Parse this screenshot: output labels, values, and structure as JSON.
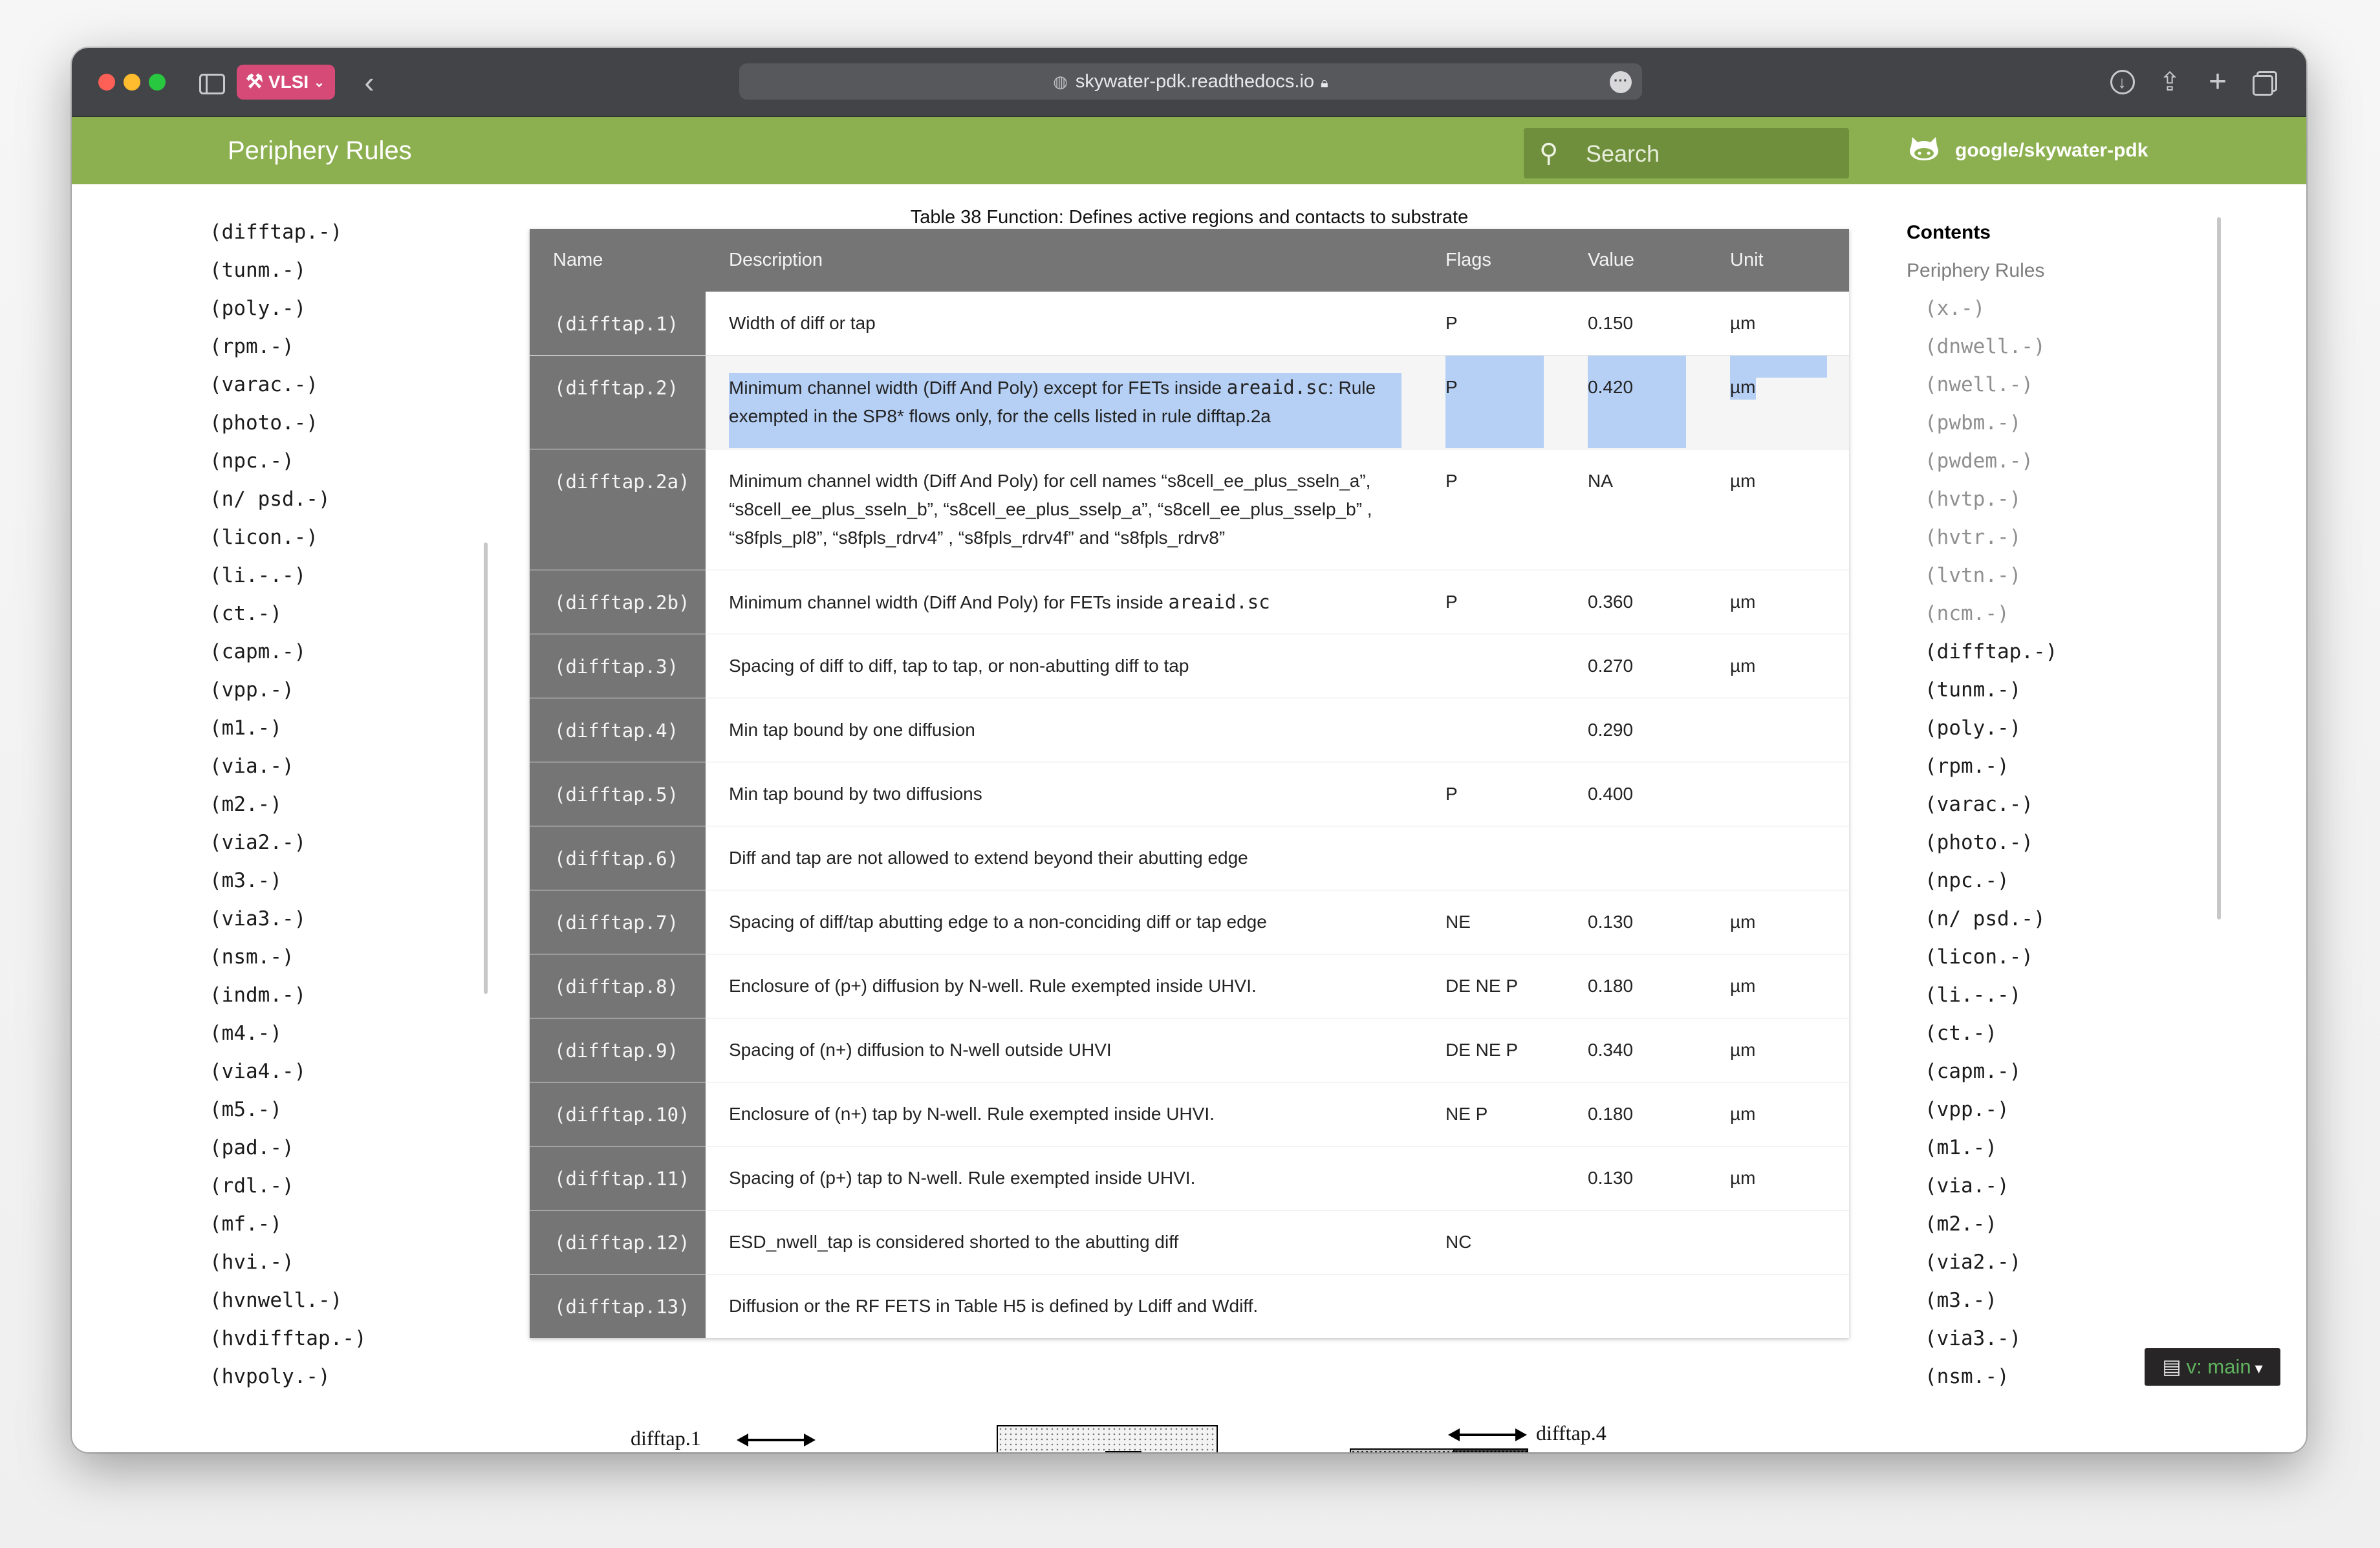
{
  "browser": {
    "tab_group_label": "VLSI",
    "url": "skywater-pdk.readthedocs.io"
  },
  "header": {
    "title": "Periphery Rules",
    "search_placeholder": "Search",
    "repo": "google/skywater-pdk"
  },
  "left_nav": [
    "(difftap.-)",
    "(tunm.-)",
    "(poly.-)",
    "(rpm.-)",
    "(varac.-)",
    "(photo.-)",
    "(npc.-)",
    "(n/ psd.-)",
    "(licon.-)",
    "(li.-.-)",
    "(ct.-)",
    "(capm.-)",
    "(vpp.-)",
    "(m1.-)",
    "(via.-)",
    "(m2.-)",
    "(via2.-)",
    "(m3.-)",
    "(via3.-)",
    "(nsm.-)",
    "(indm.-)",
    "(m4.-)",
    "(via4.-)",
    "(m5.-)",
    "(pad.-)",
    "(rdl.-)",
    "(mf.-)",
    "(hvi.-)",
    "(hvnwell.-)",
    "(hvdifftap.-)",
    "(hvpoly.-)"
  ],
  "toc": {
    "title": "Contents",
    "root": "Periphery Rules",
    "items": [
      "(x.-)",
      "(dnwell.-)",
      "(nwell.-)",
      "(pwbm.-)",
      "(pwdem.-)",
      "(hvtp.-)",
      "(hvtr.-)",
      "(lvtn.-)",
      "(ncm.-)",
      "(difftap.-)",
      "(tunm.-)",
      "(poly.-)",
      "(rpm.-)",
      "(varac.-)",
      "(photo.-)",
      "(npc.-)",
      "(n/ psd.-)",
      "(licon.-)",
      "(li.-.-)",
      "(ct.-)",
      "(capm.-)",
      "(vpp.-)",
      "(m1.-)",
      "(via.-)",
      "(m2.-)",
      "(via2.-)",
      "(m3.-)",
      "(via3.-)",
      "(nsm.-)"
    ]
  },
  "version_badge": "v: main",
  "table": {
    "caption": "Table 38 Function: Defines active regions and contacts to substrate",
    "headers": {
      "name": "Name",
      "description": "Description",
      "flags": "Flags",
      "value": "Value",
      "unit": "Unit"
    },
    "rows": [
      {
        "name": "(difftap.1)",
        "description": "Width of diff or tap",
        "flags": "P",
        "value": "0.150",
        "unit": "µm"
      },
      {
        "name": "(difftap.2)",
        "description_pre": "Minimum channel width (Diff And Poly) except for FETs inside ",
        "description_code": "areaid.sc",
        "description_post": ": Rule exempted in the SP8* flows only, for the cells listed in rule difftap.2a",
        "flags": "P",
        "value": "0.420",
        "unit": "µm"
      },
      {
        "name": "(difftap.2a)",
        "description": "Minimum channel width (Diff And Poly) for cell names “s8cell_ee_plus_sseln_a”, “s8cell_ee_plus_sseln_b”, “s8cell_ee_plus_sselp_a”, “s8cell_ee_plus_sselp_b” , “s8fpls_pl8”, “s8fpls_rdrv4” , “s8fpls_rdrv4f” and “s8fpls_rdrv8”",
        "flags": "P",
        "value": "NA",
        "unit": "µm"
      },
      {
        "name": "(difftap.2b)",
        "description_pre": "Minimum channel width (Diff And Poly) for FETs inside ",
        "description_code": "areaid.sc",
        "flags": "P",
        "value": "0.360",
        "unit": "µm"
      },
      {
        "name": "(difftap.3)",
        "description": "Spacing of diff to diff, tap to tap, or non-abutting diff to tap",
        "flags": "",
        "value": "0.270",
        "unit": "µm"
      },
      {
        "name": "(difftap.4)",
        "description": "Min tap bound by one diffusion",
        "flags": "",
        "value": "0.290",
        "unit": ""
      },
      {
        "name": "(difftap.5)",
        "description": "Min tap bound by two diffusions",
        "flags": "P",
        "value": "0.400",
        "unit": ""
      },
      {
        "name": "(difftap.6)",
        "description": "Diff and tap are not allowed to extend beyond their abutting edge",
        "flags": "",
        "value": "",
        "unit": ""
      },
      {
        "name": "(difftap.7)",
        "description": "Spacing of diff/tap abutting edge to a non-conciding diff or tap edge",
        "flags": "NE",
        "value": "0.130",
        "unit": "µm"
      },
      {
        "name": "(difftap.8)",
        "description": "Enclosure of (p+) diffusion by N-well. Rule exempted inside UHVI.",
        "flags": "DE NE P",
        "value": "0.180",
        "unit": "µm"
      },
      {
        "name": "(difftap.9)",
        "description": "Spacing of (n+) diffusion to N-well outside UHVI",
        "flags": "DE NE P",
        "value": "0.340",
        "unit": "µm"
      },
      {
        "name": "(difftap.10)",
        "description": "Enclosure of (n+) tap by N-well. Rule exempted inside UHVI.",
        "flags": "NE P",
        "value": "0.180",
        "unit": "µm"
      },
      {
        "name": "(difftap.11)",
        "description": "Spacing of (p+) tap to N-well. Rule exempted inside UHVI.",
        "flags": "",
        "value": "0.130",
        "unit": "µm"
      },
      {
        "name": "(difftap.12)",
        "description": "ESD_nwell_tap is considered shorted to the abutting diff",
        "flags": "NC",
        "value": "",
        "unit": ""
      },
      {
        "name": "(difftap.13)",
        "description": "Diffusion or the RF FETS in Table H5 is defined by Ldiff and Wdiff.",
        "flags": "",
        "value": "",
        "unit": ""
      }
    ]
  },
  "figure": {
    "label_1": "difftap.1",
    "label_4": "difftap.4"
  }
}
